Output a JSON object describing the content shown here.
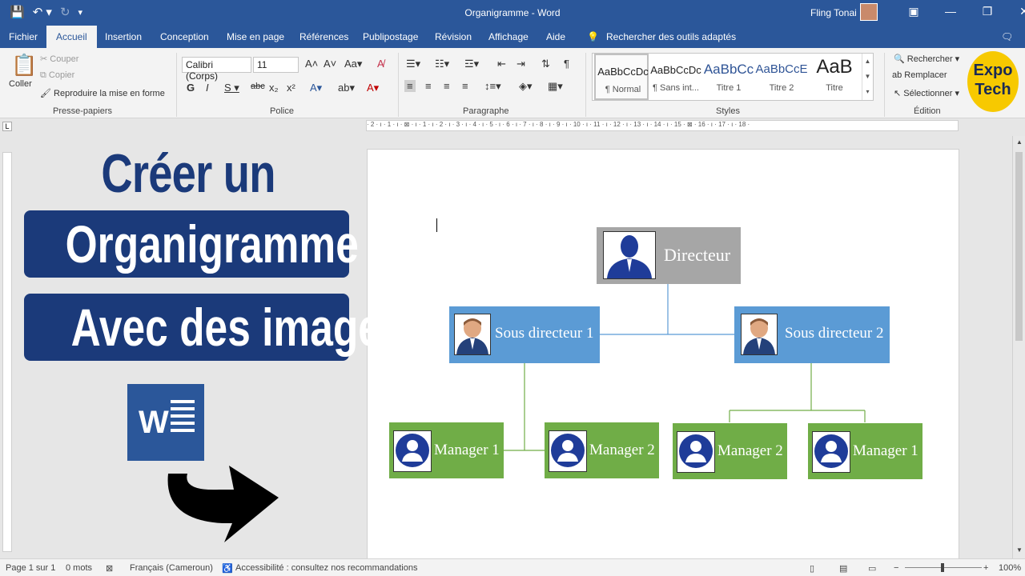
{
  "window": {
    "title": "Organigramme - Word",
    "user": "Fling Tonai"
  },
  "tabs": [
    "Fichier",
    "Accueil",
    "Insertion",
    "Conception",
    "Mise en page",
    "Références",
    "Publipostage",
    "Révision",
    "Affichage",
    "Aide"
  ],
  "tell_me": "Rechercher des outils adaptés",
  "clipboard": {
    "paste": "Coller",
    "cut": "Couper",
    "copy": "Copier",
    "format_painter": "Reproduire la mise en forme",
    "label": "Presse-papiers"
  },
  "font": {
    "name": "Calibri (Corps)",
    "size": "11",
    "label": "Police"
  },
  "paragraph": {
    "label": "Paragraphe"
  },
  "styles": {
    "label": "Styles",
    "items": [
      {
        "preview": "AaBbCcDc",
        "name": "¶ Normal"
      },
      {
        "preview": "AaBbCcDc",
        "name": "¶ Sans int..."
      },
      {
        "preview": "AaBbCc",
        "name": "Titre 1"
      },
      {
        "preview": "AaBbCcE",
        "name": "Titre 2"
      },
      {
        "preview": "AaB",
        "name": "Titre"
      }
    ]
  },
  "editing": {
    "find": "Rechercher",
    "replace": "Remplacer",
    "select": "Sélectionner",
    "label": "Édition"
  },
  "logo": {
    "line1": "Expo",
    "line2": "Tech"
  },
  "ruler_text": "· 2 · ı · 1 · ı · ⊠ · ı · 1 · ı · 2 · ı · 3 · ı · 4 · ı · 5 · ı · 6 · ı · 7 · ı · 8 · ı · 9 · ı · 10 · ı · 11 · ı · 12 · ı · 13 · ı · 14 · ı · 15 · ⊠ · 16 · ı · 17 · ı · 18 ·",
  "overlay": {
    "line1": "Créer un",
    "line2": "Organigramme",
    "line3": "Avec des images",
    "word_letter": "W"
  },
  "org_chart": {
    "director": "Directeur",
    "sub1": "Sous directeur 1",
    "sub2": "Sous directeur 2",
    "managers": [
      "Manager 1",
      "Manager 2",
      "Manager 2",
      "Manager 1"
    ],
    "colors": {
      "director": "#a6a6a6",
      "sub": "#5b9bd5",
      "manager": "#70ad47"
    }
  },
  "status": {
    "page": "Page 1 sur 1",
    "words": "0 mots",
    "language": "Français (Cameroun)",
    "accessibility": "Accessibilité : consultez nos recommandations",
    "zoom": "100%"
  }
}
